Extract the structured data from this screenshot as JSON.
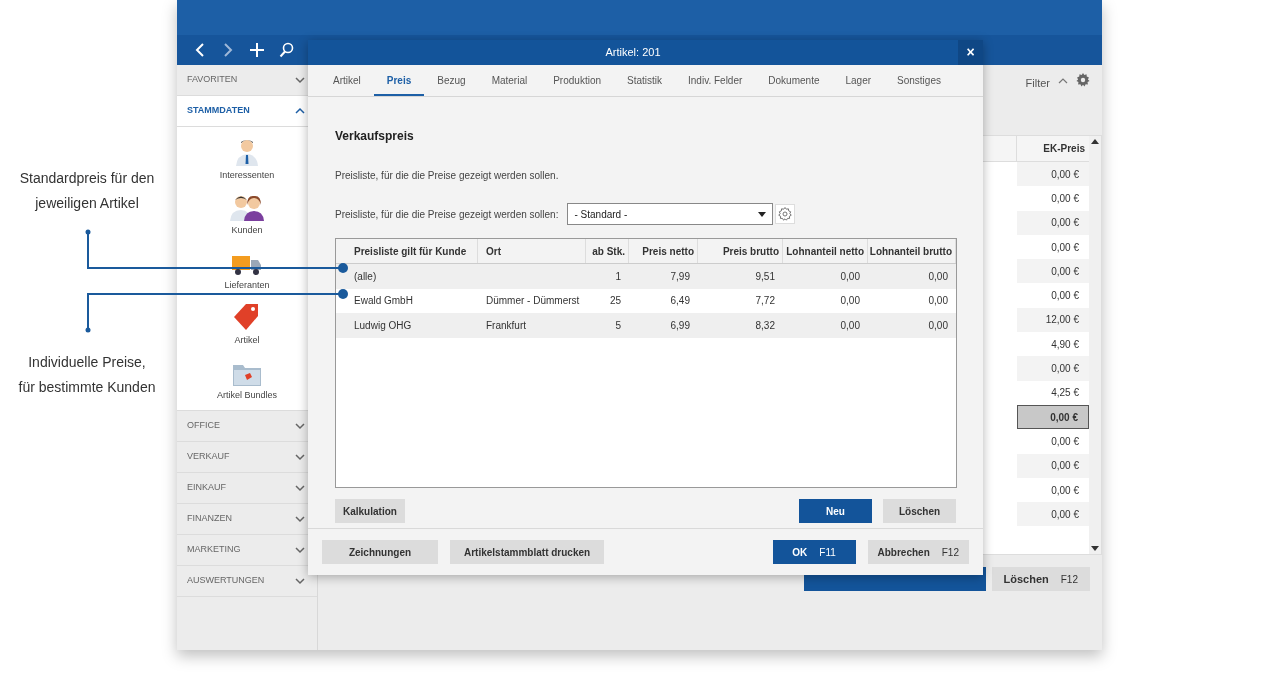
{
  "callouts": [
    {
      "text": "Standardpreis für den\njeweiligen Artikel"
    },
    {
      "text": "Individuelle Preise,\nfür bestimmte Kunden"
    }
  ],
  "sidebar": {
    "sections": [
      {
        "label": "FAVORITEN",
        "expanded": false
      },
      {
        "label": "STAMMDATEN",
        "expanded": true,
        "items": [
          {
            "label": "Interessenten",
            "kind": "person"
          },
          {
            "label": "Kunden",
            "kind": "people"
          },
          {
            "label": "Lieferanten",
            "kind": "truck"
          },
          {
            "label": "Artikel",
            "kind": "tag"
          },
          {
            "label": "Artikel Bundles",
            "kind": "folder"
          }
        ]
      },
      {
        "label": "OFFICE",
        "expanded": false
      },
      {
        "label": "VERKAUF",
        "expanded": false
      },
      {
        "label": "EINKAUF",
        "expanded": false
      },
      {
        "label": "FINANZEN",
        "expanded": false
      },
      {
        "label": "MARKETING",
        "expanded": false
      },
      {
        "label": "AUSWERTUNGEN",
        "expanded": false
      }
    ]
  },
  "toolbar": {
    "filter": "Filter"
  },
  "list": {
    "column": "EK-Preis",
    "rows": [
      {
        "value": "0,00 €",
        "selected": false
      },
      {
        "value": "0,00 €",
        "selected": false
      },
      {
        "value": "0,00 €",
        "selected": false
      },
      {
        "value": "0,00 €",
        "selected": false
      },
      {
        "value": "0,00 €",
        "selected": false
      },
      {
        "value": "0,00 €",
        "selected": false
      },
      {
        "value": "12,00 €",
        "selected": false
      },
      {
        "value": "4,90 €",
        "selected": false
      },
      {
        "value": "0,00 €",
        "selected": false
      },
      {
        "value": "4,25 €",
        "selected": false
      },
      {
        "value": "0,00 €",
        "selected": true
      },
      {
        "value": "0,00 €",
        "selected": false
      },
      {
        "value": "0,00 €",
        "selected": false
      },
      {
        "value": "0,00 €",
        "selected": false
      },
      {
        "value": "0,00 €",
        "selected": false
      }
    ]
  },
  "bottom_button": {
    "label": "Löschen",
    "key": "F12"
  },
  "dialog": {
    "title": "Artikel: 201",
    "close": "×",
    "tabs": [
      {
        "label": "Artikel",
        "selected": false
      },
      {
        "label": "Preis",
        "selected": true
      },
      {
        "label": "Bezug",
        "selected": false
      },
      {
        "label": "Material",
        "selected": false
      },
      {
        "label": "Produktion",
        "selected": false
      },
      {
        "label": "Statistik",
        "selected": false
      },
      {
        "label": "Indiv. Felder",
        "selected": false
      },
      {
        "label": "Dokumente",
        "selected": false
      },
      {
        "label": "Lager",
        "selected": false
      },
      {
        "label": "Sonstiges",
        "selected": false
      }
    ],
    "heading": "Verkaufspreis",
    "description": "Preisliste, für die die Preise gezeigt werden sollen.",
    "pricelist_label": "Preisliste, für die die Preise gezeigt werden sollen:",
    "pricelist_value": "- Standard -",
    "table": {
      "columns": [
        "Preisliste gilt für Kunde",
        "Ort",
        "ab Stk.",
        "Preis netto",
        "Preis brutto",
        "Lohnanteil netto",
        "Lohnanteil brutto"
      ],
      "rows": [
        [
          "(alle)",
          "",
          "1",
          "7,99",
          "9,51",
          "0,00",
          "0,00"
        ],
        [
          "Ewald GmbH",
          "Dümmer - Dümmerst",
          "25",
          "6,49",
          "7,72",
          "0,00",
          "0,00"
        ],
        [
          "Ludwig OHG",
          "Frankfurt",
          "5",
          "6,99",
          "8,32",
          "0,00",
          "0,00"
        ]
      ]
    },
    "buttons": [
      {
        "label": "Kalkulation",
        "kind": "secondary"
      },
      {
        "label": "Neu",
        "kind": "primary"
      },
      {
        "label": "Löschen",
        "kind": "secondary"
      }
    ],
    "footer_buttons": [
      {
        "label": "Zeichnungen",
        "kind": "secondary"
      },
      {
        "label": "Artikelstammblatt drucken",
        "kind": "secondary"
      },
      {
        "label": "OK",
        "key": "F11",
        "kind": "primary"
      },
      {
        "label": "Abbrechen",
        "key": "F12",
        "kind": "secondary"
      }
    ]
  }
}
